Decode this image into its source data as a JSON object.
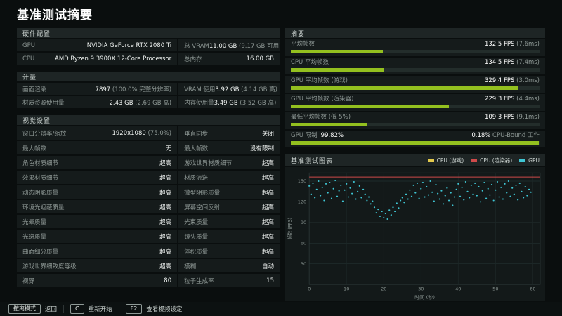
{
  "title": "基准测试摘要",
  "colors": {
    "green": "#93c01f",
    "cyan": "#3fc6d4",
    "yellow": "#e3c94c",
    "red": "#cf4a4a"
  },
  "hardware": {
    "header": "硬件配置",
    "rows": [
      {
        "cells": [
          {
            "label": "GPU",
            "value": "NVIDIA GeForce RTX 2080 Ti",
            "sub": ""
          },
          {
            "label": "总 VRAM",
            "value": "11.00 GB",
            "sub": "(9.17 GB 可用)"
          }
        ]
      },
      {
        "cells": [
          {
            "label": "CPU",
            "value": "AMD Ryzen 9 3900X 12-Core Processor",
            "sub": ""
          },
          {
            "label": "总内存",
            "value": "16.00 GB",
            "sub": ""
          }
        ]
      }
    ]
  },
  "metrics": {
    "header": "计量",
    "rows": [
      {
        "cells": [
          {
            "label": "画面渲染",
            "value": "7897",
            "sub": "(100.0% 完整分辨率)"
          },
          {
            "label": "VRAM 使用",
            "value": "3.92 GB",
            "sub": "(4.14 GB 高)"
          }
        ]
      },
      {
        "cells": [
          {
            "label": "材质资源使用量",
            "value": "2.43 GB",
            "sub": "(2.69 GB 高)"
          },
          {
            "label": "内存使用量",
            "value": "3.49 GB",
            "sub": "(3.52 GB 高)"
          }
        ]
      }
    ]
  },
  "visual_settings": {
    "header": "视觉设置",
    "rows": [
      {
        "cells": [
          {
            "label": "窗口分辨率/缩放",
            "value": "1920x1080",
            "sub": "(75.0%)"
          },
          {
            "label": "垂直同步",
            "value": "关闭",
            "sub": ""
          }
        ]
      },
      {
        "cells": [
          {
            "label": "最大帧数",
            "value": "无",
            "sub": ""
          },
          {
            "label": "最大帧数",
            "value": "没有限制",
            "sub": ""
          }
        ]
      },
      {
        "cells": [
          {
            "label": "角色材质细节",
            "value": "超高",
            "sub": ""
          },
          {
            "label": "游戏世界材质细节",
            "value": "超高",
            "sub": ""
          }
        ]
      },
      {
        "cells": [
          {
            "label": "效果材质细节",
            "value": "超高",
            "sub": ""
          },
          {
            "label": "材质流送",
            "value": "超高",
            "sub": ""
          }
        ]
      },
      {
        "cells": [
          {
            "label": "动态阴影质量",
            "value": "超高",
            "sub": ""
          },
          {
            "label": "微型阴影质量",
            "value": "超高",
            "sub": ""
          }
        ]
      },
      {
        "cells": [
          {
            "label": "环境光遮蔽质量",
            "value": "超高",
            "sub": ""
          },
          {
            "label": "屏幕空间反射",
            "value": "超高",
            "sub": ""
          }
        ]
      },
      {
        "cells": [
          {
            "label": "光晕质量",
            "value": "超高",
            "sub": ""
          },
          {
            "label": "光束质量",
            "value": "超高",
            "sub": ""
          }
        ]
      },
      {
        "cells": [
          {
            "label": "光斑质量",
            "value": "超高",
            "sub": ""
          },
          {
            "label": "镜头质量",
            "value": "超高",
            "sub": ""
          }
        ]
      },
      {
        "cells": [
          {
            "label": "曲面细分质量",
            "value": "超高",
            "sub": ""
          },
          {
            "label": "体积质量",
            "value": "超高",
            "sub": ""
          }
        ]
      },
      {
        "cells": [
          {
            "label": "游戏世界细致度等级",
            "value": "超高",
            "sub": ""
          },
          {
            "label": "模糊",
            "value": "自动",
            "sub": ""
          }
        ]
      },
      {
        "cells": [
          {
            "label": "视野",
            "value": "80",
            "sub": ""
          },
          {
            "label": "粒子生成率",
            "value": "15",
            "sub": ""
          }
        ]
      }
    ]
  },
  "summary": {
    "header": "摘要",
    "rows": [
      {
        "label": "平均帧数",
        "label_value": "",
        "value": "132.5 FPS",
        "value_sub": "(7.6ms)",
        "bar_pct": 37
      },
      {
        "label": "CPU 平均帧数",
        "label_value": "",
        "value": "134.5 FPS",
        "value_sub": "(7.4ms)",
        "bar_pct": 37.5
      },
      {
        "label": "GPU 平均帧数 (游戏)",
        "label_value": "",
        "value": "329.4 FPS",
        "value_sub": "(3.0ms)",
        "bar_pct": 91.5
      },
      {
        "label": "GPU 平均帧数 (渲染器)",
        "label_value": "",
        "value": "229.3 FPS",
        "value_sub": "(4.4ms)",
        "bar_pct": 63.7
      },
      {
        "label": "最低平均帧数 (低 5%)",
        "label_value": "",
        "value": "109.3 FPS",
        "value_sub": "(9.1ms)",
        "bar_pct": 30.4
      },
      {
        "label": "GPU 限制",
        "label_value": "99.82%",
        "value": "0.18%",
        "value_sub": "CPU-Bound 工作",
        "bar_pct": 99.8
      }
    ]
  },
  "chart": {
    "header": "基准测试图表",
    "legend": [
      {
        "label": "CPU (游戏)",
        "color": "#e3c94c"
      },
      {
        "label": "CPU (渲染器)",
        "color": "#cf4a4a"
      },
      {
        "label": "GPU",
        "color": "#3fc6d4"
      }
    ]
  },
  "chart_data": {
    "type": "scatter",
    "title": "基准测试图表",
    "xlabel": "时间 (秒)",
    "ylabel": "帧数 (FPS)",
    "xlim": [
      0,
      62
    ],
    "ylim": [
      0,
      162
    ],
    "xticks": [
      0,
      10,
      20,
      30,
      40,
      50,
      60
    ],
    "yticks": [
      30,
      60,
      90,
      120,
      150
    ],
    "grid": true,
    "legend_position": "top-right",
    "series": [
      {
        "name": "GPU",
        "type": "scatter",
        "color": "#3fc6d4",
        "x_start": 0,
        "x_step": 0.5,
        "values": [
          143,
          131,
          147,
          126,
          138,
          150,
          129,
          141,
          122,
          146,
          133,
          148,
          125,
          139,
          151,
          128,
          136,
          144,
          121,
          137,
          146,
          127,
          140,
          132,
          149,
          124,
          135,
          143,
          126,
          138,
          131,
          122,
          127,
          117,
          121,
          112,
          104,
          109,
          99,
          106,
          97,
          103,
          95,
          108,
          101,
          112,
          106,
          118,
          111,
          122,
          126,
          119,
          131,
          124,
          137,
          128,
          144,
          133,
          147,
          125,
          139,
          148,
          127,
          142,
          130,
          150,
          134,
          121,
          145,
          132,
          124,
          136,
          117,
          129,
          140,
          122,
          133,
          115,
          127,
          138,
          146,
          128,
          141,
          123,
          149,
          135,
          126,
          144,
          131,
          147,
          129,
          142,
          120,
          136,
          148,
          125,
          139,
          130,
          145,
          122,
          137,
          149,
          127,
          141,
          124,
          146,
          133,
          150,
          128,
          140,
          131,
          144,
          123,
          147,
          135,
          126,
          142,
          129,
          138,
          134
        ]
      },
      {
        "name": "CPU (渲染器)",
        "type": "line",
        "color": "#cf4a4a",
        "display_value": 156,
        "note": "average 229.3 FPS, clipped at top of plot"
      },
      {
        "name": "CPU (游戏)",
        "type": "line",
        "color": "#e3c94c",
        "offscreen": true,
        "note": "average 329.4 FPS, above plot range"
      }
    ]
  },
  "footer": {
    "items": [
      {
        "key": "撤离模式",
        "label": "返回"
      },
      {
        "key": "C",
        "label": "重新开始"
      },
      {
        "key": "F2",
        "label": "查看视频设定"
      }
    ]
  }
}
